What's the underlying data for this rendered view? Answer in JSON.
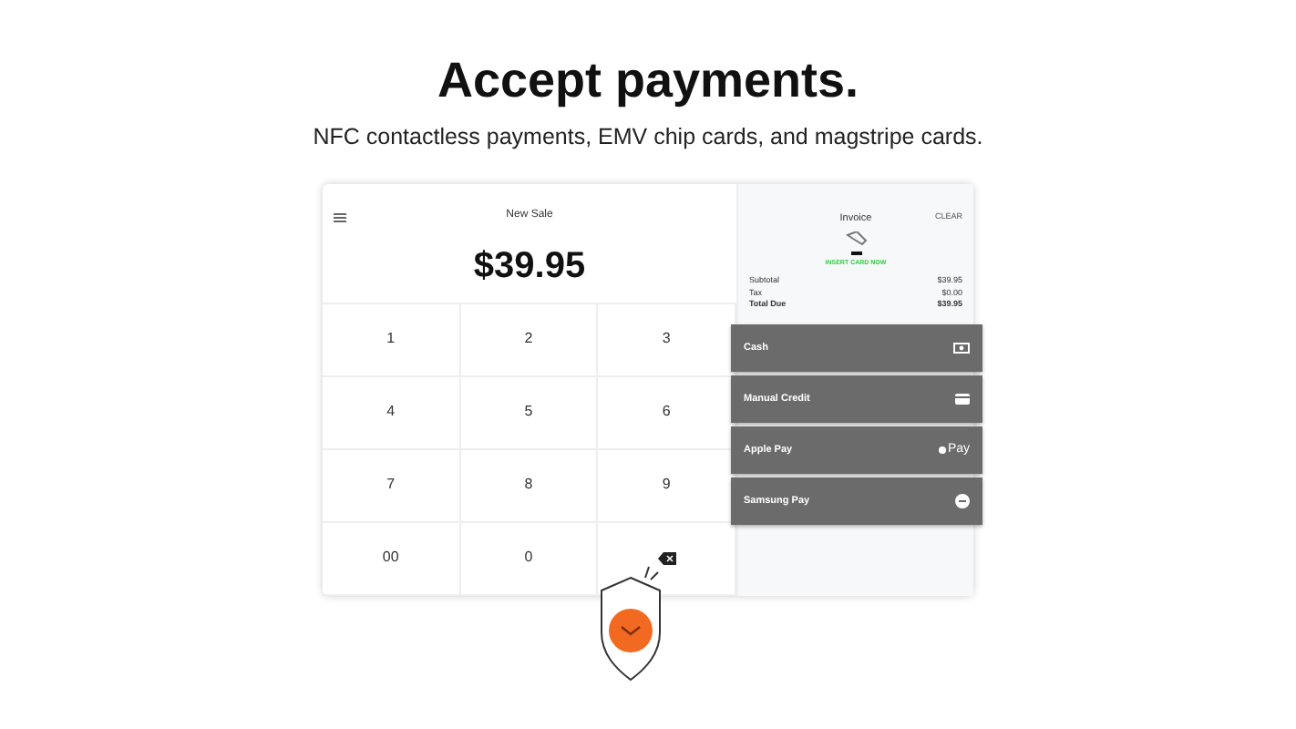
{
  "heading": "Accept payments.",
  "subheading": "NFC contactless payments, EMV chip cards, and magstripe cards.",
  "sale": {
    "title": "New Sale",
    "amount": "$39.95"
  },
  "keypad": [
    "1",
    "2",
    "3",
    "4",
    "5",
    "6",
    "7",
    "8",
    "9",
    "00",
    "0",
    {
      "kind": "backspace"
    }
  ],
  "invoice": {
    "title": "Invoice",
    "clear": "CLEAR",
    "prompt": "INSERT CARD NOW",
    "lines": [
      {
        "label": "Subtotal",
        "value": "$39.95"
      },
      {
        "label": "Tax",
        "value": "$0.00"
      },
      {
        "label": "Total Due",
        "value": "$39.95"
      }
    ]
  },
  "payments": [
    {
      "label": "Cash",
      "kind": "cash"
    },
    {
      "label": "Manual Credit",
      "kind": "card"
    },
    {
      "label": "Apple Pay",
      "kind": "applepay",
      "mark": "Pay"
    },
    {
      "label": "Samsung Pay",
      "kind": "samsung"
    }
  ]
}
